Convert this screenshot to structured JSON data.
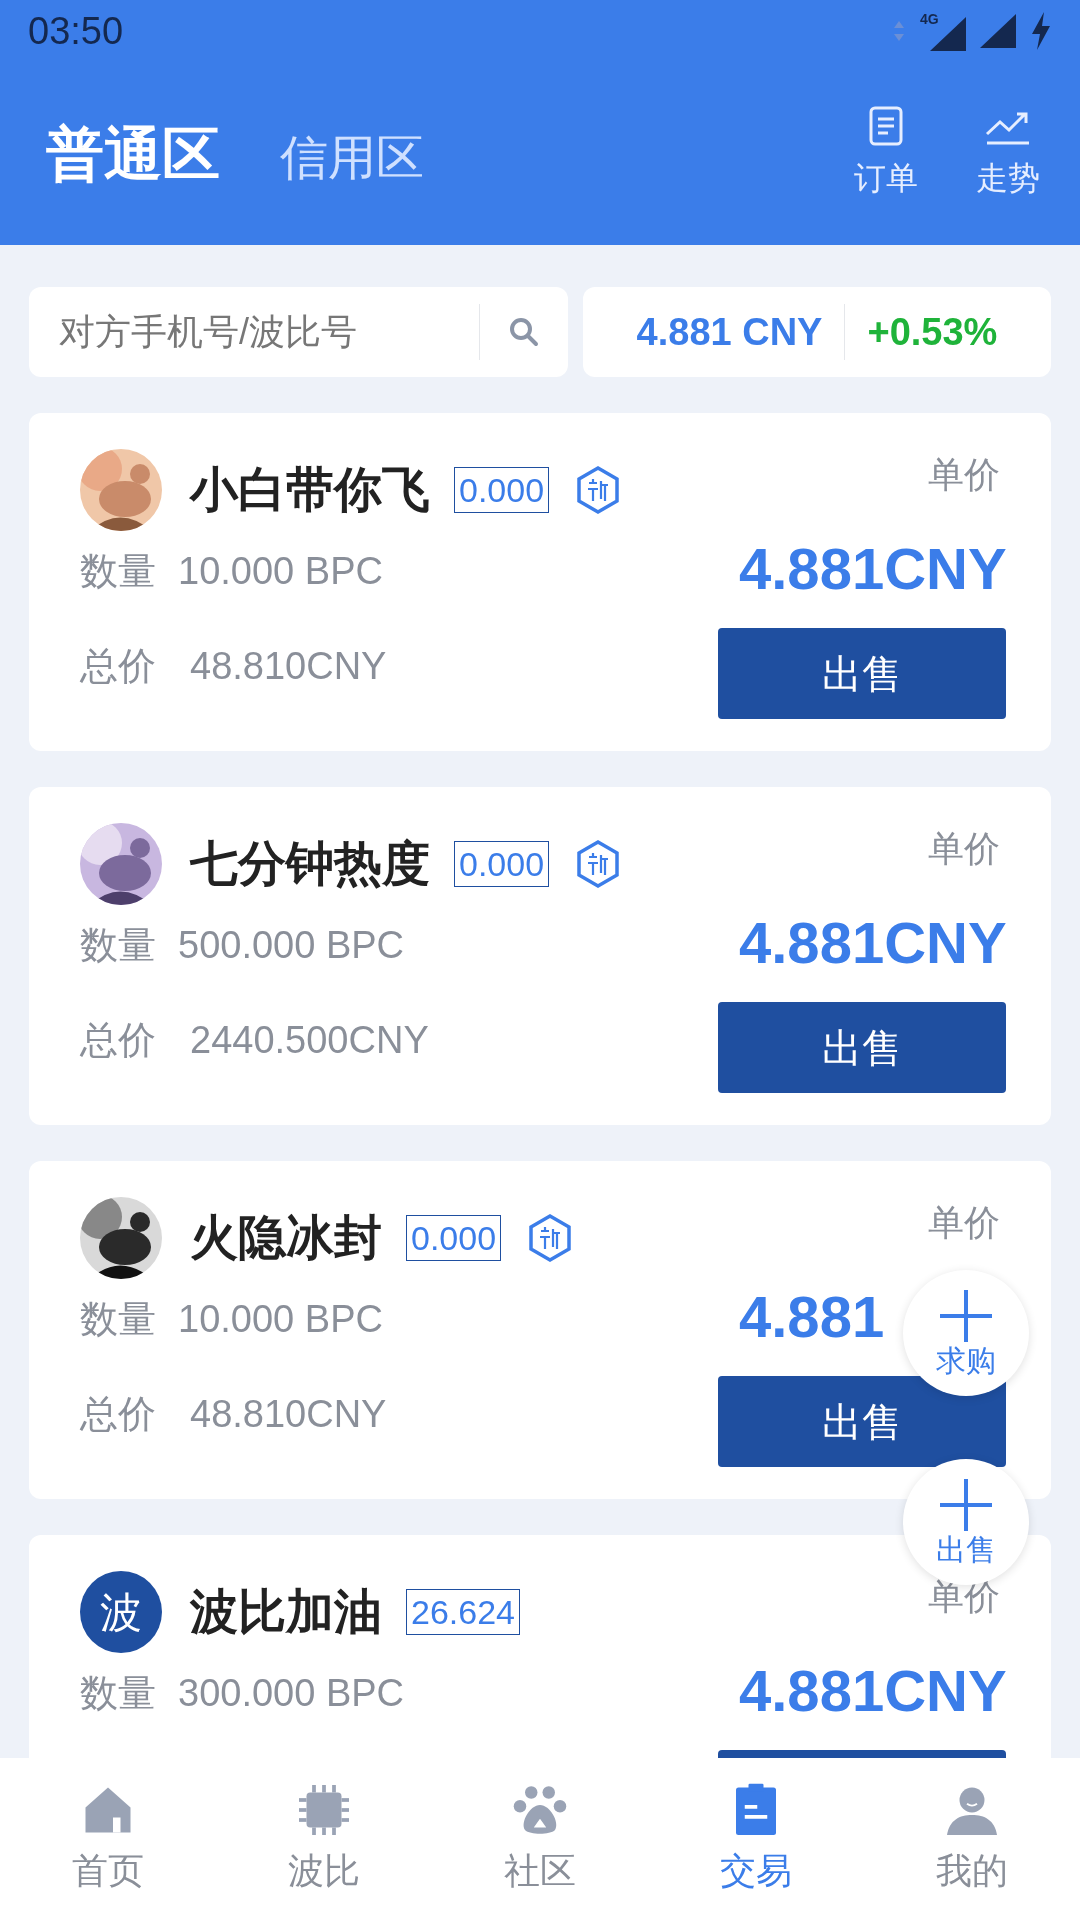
{
  "status_bar": {
    "time": "03:50",
    "network": "4G"
  },
  "header": {
    "tabs": [
      {
        "label": "普通区",
        "selected": true
      },
      {
        "label": "信用区",
        "selected": false
      }
    ],
    "actions": [
      {
        "kind": "orders",
        "label": "订单"
      },
      {
        "kind": "trend",
        "label": "走势"
      }
    ]
  },
  "search": {
    "placeholder": "对方手机号/波比号"
  },
  "ticker": {
    "price": "4.881 CNY",
    "change": "+0.53%"
  },
  "listings": [
    {
      "name": "小白带你飞",
      "score": "0.000",
      "new": true,
      "price_label": "单价",
      "price": "4.881CNY",
      "quantity_label": "数量",
      "quantity": "10.000 BPC",
      "total_label": "总价",
      "total": "48.810CNY",
      "button": "出售"
    },
    {
      "name": "七分钟热度",
      "score": "0.000",
      "new": true,
      "price_label": "单价",
      "price": "4.881CNY",
      "quantity_label": "数量",
      "quantity": "500.000 BPC",
      "total_label": "总价",
      "total": "2440.500CNY",
      "button": "出售"
    },
    {
      "name": "火隐冰封",
      "score": "0.000",
      "new": true,
      "price_label": "单价",
      "price": "4.881",
      "quantity_label": "数量",
      "quantity": "10.000 BPC",
      "total_label": "总价",
      "total": "48.810CNY",
      "button": "出售"
    },
    {
      "avatar": {
        "kind": "letter",
        "text": "波"
      },
      "name": "波比加油",
      "score": "26.624",
      "new": false,
      "price_label": "单价",
      "price": "4.881CNY",
      "quantity_label": "数量",
      "quantity": "300.000 BPC"
    }
  ],
  "floating_buttons": [
    {
      "label": "求购"
    },
    {
      "label": "出售"
    }
  ],
  "nav": [
    {
      "label": "首页",
      "selected": false
    },
    {
      "label": "波比",
      "selected": false
    },
    {
      "label": "社区",
      "selected": false
    },
    {
      "label": "交易",
      "selected": true
    },
    {
      "label": "我的",
      "selected": false
    }
  ]
}
